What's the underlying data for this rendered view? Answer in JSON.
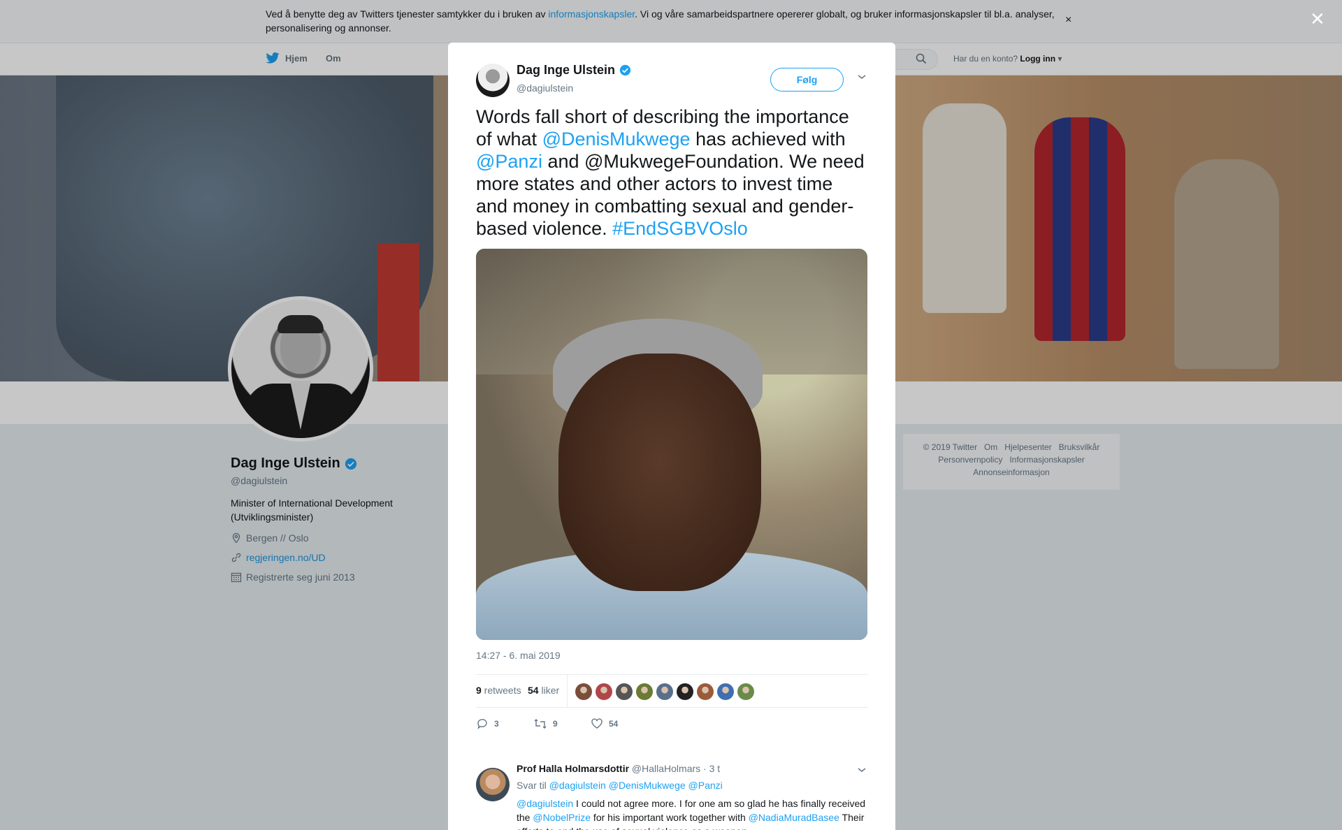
{
  "cookie_banner": {
    "text_before": "Ved å benytte deg av Twitters tjenester samtykker du i bruken av ",
    "link": "informasjonskapsler",
    "text_after": ". Vi og våre samarbeidspartnere opererer globalt, og bruker informasjonskapsler til bl.a. analyser, personalisering og annonser.",
    "close": "×"
  },
  "nav": {
    "home": "Hjem",
    "about": "Om",
    "login_prompt": "Har du en konto?",
    "login": "Logg inn"
  },
  "profile": {
    "name": "Dag Inge Ulstein",
    "handle": "@dagiulstein",
    "bio": "Minister of International Development (Utviklingsminister)",
    "location": "Bergen // Oslo",
    "website": "regjeringen.no/UD",
    "joined": "Registrerte seg juni 2013"
  },
  "footer": {
    "links_row1": [
      "© 2019 Twitter",
      "Om",
      "Hjelpesenter",
      "Bruksvilkår"
    ],
    "links_row2": [
      "Personvernpolicy",
      "Informasjonskapsler"
    ],
    "links_row3": [
      "Annonseinformasjon"
    ]
  },
  "modal": {
    "close": "✕",
    "author_name": "Dag Inge Ulstein",
    "author_handle": "@dagiulstein",
    "follow": "Følg",
    "tweet": {
      "t1": "Words fall short of describing the importance of what ",
      "l1": "@DenisMukwege",
      "t2": " has achieved with ",
      "l2": "@Panzi",
      "t3": " and @MukwegeFoundation. We need more states and other actors to invest time and money in combatting sexual and gender-based violence. ",
      "l3": "#EndSGBVOslo"
    },
    "timestamp": "14:27 - 6. mai 2019",
    "retweets_count": "9",
    "retweets_label": " retweets",
    "likes_count": "54",
    "likes_label": " liker",
    "likers_colors": [
      "#7a4e3a",
      "#b0464a",
      "#555555",
      "#6b7a34",
      "#5a6f8c",
      "#222222",
      "#9b5b3a",
      "#3f6fb0",
      "#6a8a4a"
    ],
    "actions": {
      "replies": "3",
      "retweets": "9",
      "likes": "54"
    }
  },
  "reply": {
    "name": "Prof Halla Holmarsdottir",
    "handle": "@HallaHolmars",
    "time": " · 3 t",
    "reply_to_label": "Svar til ",
    "reply_to": "@dagiulstein @DenisMukwege @Panzi",
    "l1": "@dagiulstein",
    "t1": " I could not agree more.  I for one am so glad he has finally received the ",
    "l2": "@NobelPrize",
    "t2": " for his important work together with ",
    "l3": "@NadiaMuradBasee",
    "t3": " Their efforts to end the use of sexual violence as a weapon"
  }
}
